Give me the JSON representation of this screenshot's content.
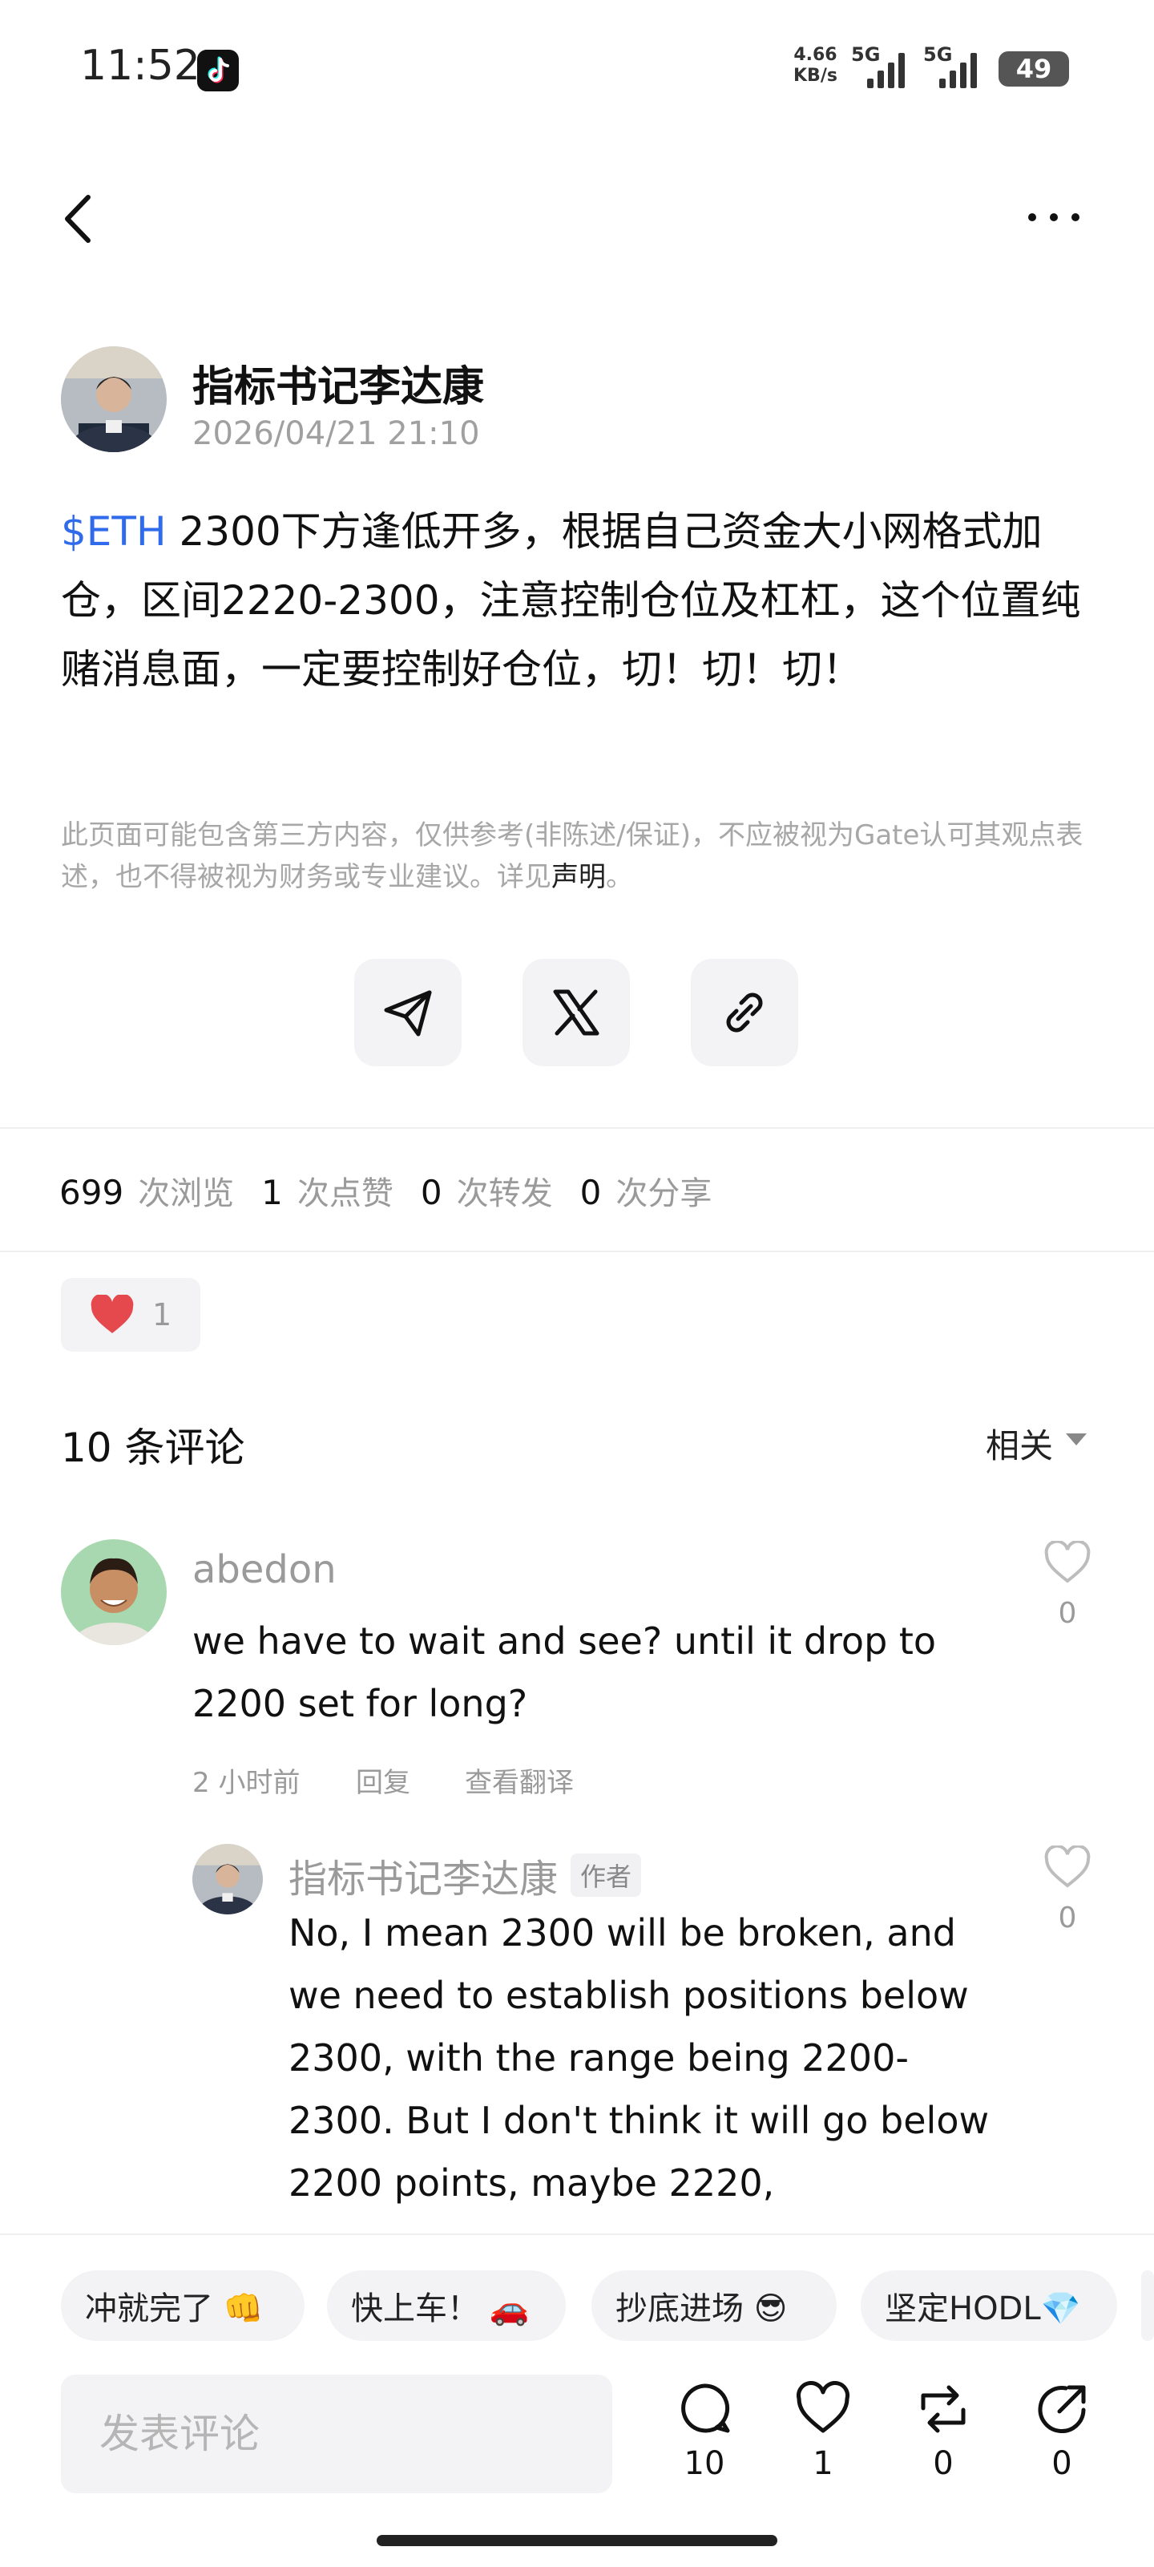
{
  "status_bar": {
    "time": "11:52",
    "net_speed_value": "4.66",
    "net_speed_unit": "KB/s",
    "signal1_label": "5G",
    "signal2_label": "5G",
    "battery": "49"
  },
  "post": {
    "author_name": "指标书记李达康",
    "timestamp": "2026/04/21 21:10",
    "cashtag": "$ETH",
    "body": " 2300下方逢低开多，根据自己资金大小网格式加仓，区间2220-2300，注意控制仓位及杠杠，这个位置纯赌消息面，一定要控制好仓位，切！切！切！",
    "disclaimer_text": "此页面可能包含第三方内容，仅供参考(非陈述/保证)，不应被视为Gate认可其观点表述，也不得被视为财务或专业建议。详见",
    "disclaimer_link": "声明",
    "disclaimer_end": "。"
  },
  "stats": {
    "views": "699",
    "views_label": "次浏览",
    "likes": "1",
    "likes_label": "次点赞",
    "reposts": "0",
    "reposts_label": "次转发",
    "shares": "0",
    "shares_label": "次分享"
  },
  "reaction": {
    "heart_count": "1"
  },
  "comments": {
    "title": "10 条评论",
    "sort": "相关",
    "items": [
      {
        "user": "abedon",
        "text": "we have to wait and see? until it drop to 2200 set for long?",
        "time": "2 小时前",
        "reply": "回复",
        "translate": "查看翻译",
        "likes": "0"
      }
    ],
    "reply": {
      "user": "指标书记李达康",
      "tag": "作者",
      "text": "No, I mean 2300 will be broken, and we need to establish positions below 2300, with the range being 2200-2300. But I don't think it will go below 2200 points, maybe 2220,",
      "likes": "0"
    }
  },
  "quick_replies": [
    "冲就完了 👊",
    "快上车！ 🚗",
    "抄底进场 😎",
    "坚定HODL💎"
  ],
  "composer": {
    "placeholder": "发表评论"
  },
  "actions": {
    "comments": "10",
    "likes": "1",
    "reposts": "0",
    "shares": "0"
  },
  "colors": {
    "cashtag": "#2F6BEB",
    "heart": "#E5484D"
  }
}
